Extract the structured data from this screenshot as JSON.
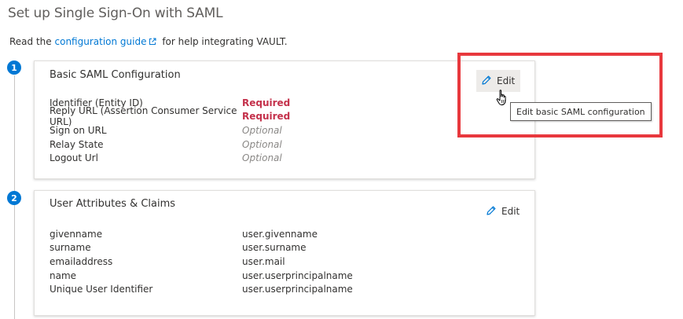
{
  "page": {
    "title": "Set up Single Sign-On with SAML",
    "intro_prefix": "Read the",
    "intro_link": "configuration guide",
    "intro_suffix": "for help integrating VAULT."
  },
  "steps": [
    "1",
    "2"
  ],
  "basic_saml": {
    "title": "Basic SAML Configuration",
    "edit_label": "Edit",
    "tooltip": "Edit basic SAML configuration",
    "rows": [
      {
        "label": "Identifier (Entity ID)",
        "value": "Required",
        "status": "required"
      },
      {
        "label": "Reply URL (Assertion Consumer Service URL)",
        "value": "Required",
        "status": "required"
      },
      {
        "label": "Sign on URL",
        "value": "Optional",
        "status": "optional"
      },
      {
        "label": "Relay State",
        "value": "Optional",
        "status": "optional"
      },
      {
        "label": "Logout Url",
        "value": "Optional",
        "status": "optional"
      }
    ]
  },
  "user_attributes": {
    "title": "User Attributes & Claims",
    "edit_label": "Edit",
    "rows": [
      {
        "label": "givenname",
        "value": "user.givenname"
      },
      {
        "label": "surname",
        "value": "user.surname"
      },
      {
        "label": "emailaddress",
        "value": "user.mail"
      },
      {
        "label": "name",
        "value": "user.userprincipalname"
      },
      {
        "label": "Unique User Identifier",
        "value": "user.userprincipalname"
      }
    ]
  },
  "colors": {
    "accent": "#0078d4",
    "required": "#c4314b",
    "highlight": "#e8383d"
  },
  "icons": [
    "external-link-icon",
    "pencil-icon",
    "hand-cursor-icon"
  ]
}
